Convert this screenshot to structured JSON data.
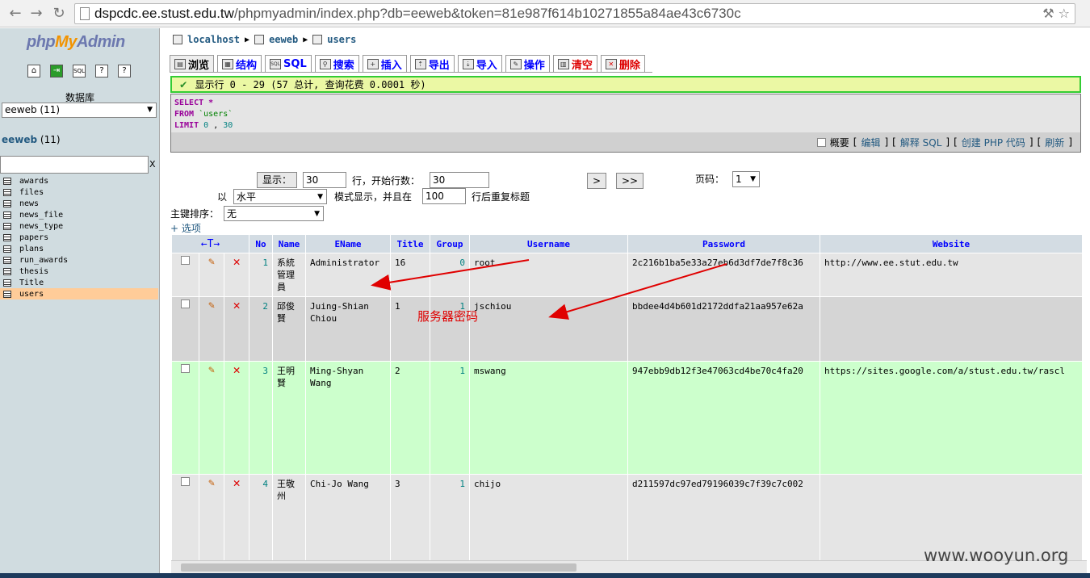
{
  "browser": {
    "url_host": "dspcdc.ee.stust.edu.tw",
    "url_path": "/phpmyadmin/index.php?db=eeweb&token=81e987f614b10271855a84ae43c6730c"
  },
  "sidebar": {
    "logo_php": "php",
    "logo_my": "My",
    "logo_admin": "Admin",
    "db_label": "数据库",
    "db_select": "eeweb (11)",
    "db_name": "eeweb",
    "db_count": "(11)",
    "filter_clear": "X",
    "tables": [
      "awards",
      "files",
      "news",
      "news_file",
      "news_type",
      "papers",
      "plans",
      "run_awards",
      "thesis",
      "Title",
      "users"
    ]
  },
  "breadcrumb": {
    "server": "localhost",
    "database": "eeweb",
    "table": "users"
  },
  "tabs": [
    "浏览",
    "结构",
    "SQL",
    "搜索",
    "插入",
    "导出",
    "导入",
    "操作",
    "清空",
    "删除"
  ],
  "success": "显示行 0 - 29 (57 总计, 查询花费 0.0001 秒)",
  "sql": {
    "select_kw": "SELECT",
    "select_rest": "*",
    "from_kw": "FROM",
    "from_table": "`users`",
    "limit_kw": "LIMIT",
    "limit_a": "0",
    "limit_sep": ",",
    "limit_b": "30"
  },
  "sql_actions": {
    "profiling": "概要",
    "edit": "编辑",
    "explain": "解释 SQL",
    "create_php": "创建 PHP 代码",
    "refresh": "刷新",
    "bracket_open": "[",
    "bracket_close": "]"
  },
  "nav": {
    "show_button": "显示：",
    "rows_value": "30",
    "start_label": "行，开始行数：",
    "start_value": "30",
    "next": ">",
    "last": ">>",
    "page_label": "页码：",
    "page_value": "1",
    "mode_prefix": "以",
    "mode_value": "水平",
    "mode_suffix": "模式显示，并且在",
    "repeat_value": "100",
    "repeat_suffix": "行后重复标题",
    "sort_label": "主键排序：",
    "sort_value": "无",
    "options": "+ 选项"
  },
  "grid": {
    "arrows": "←T→",
    "columns": [
      "No",
      "Name",
      "EName",
      "Title",
      "Group",
      "Username",
      "Password",
      "Website"
    ],
    "rows": [
      {
        "no": "1",
        "name": "系統管理員",
        "ename": "Administrator",
        "title": "16",
        "group": "0",
        "username": "root",
        "password": "2c216b1ba5e33a27eb6d3df7de7f8c36",
        "website": "http://www.ee.stut.edu.tw"
      },
      {
        "no": "2",
        "name": "邱俊賢",
        "ename": "Juing-Shian Chiou",
        "title": "1",
        "group": "1",
        "username": "jschiou",
        "password": "bbdee4d4b601d2172ddfa21aa957e62a",
        "website": ""
      },
      {
        "no": "3",
        "name": "王明賢",
        "ename": "Ming-Shyan Wang",
        "title": "2",
        "group": "1",
        "username": "mswang",
        "password": "947ebb9db12f3e47063cd4be70c4fa20",
        "website": "https://sites.google.com/a/stust.edu.tw/rascl"
      },
      {
        "no": "4",
        "name": "王敬州",
        "ename": "Chi-Jo Wang",
        "title": "3",
        "group": "1",
        "username": "chijo",
        "password": "d211597dc97ed79196039c7f39c7c002",
        "website": ""
      }
    ]
  },
  "annotation": "服务器密码",
  "watermark": "www.wooyun.org",
  "colors": {
    "sidebar_bg": "#d0dce0",
    "header_bg": "#d3dce3",
    "highlight_row": "#ccffcc",
    "success_border": "#33cc33",
    "annotation": "#e00000"
  }
}
